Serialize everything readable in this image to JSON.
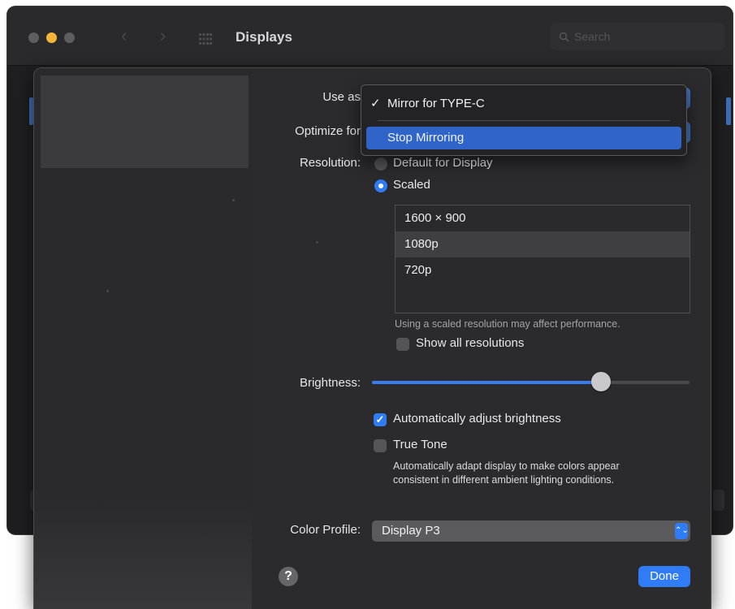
{
  "window": {
    "title": "Displays",
    "search_placeholder": "Search",
    "back_glyph": "‹",
    "forward_glyph": "›"
  },
  "sheet": {
    "use_as_label": "Use as",
    "optimize_for_label": "Optimize for",
    "resolution_label": "Resolution:",
    "resolution_options": {
      "default": "Default for Display",
      "scaled": "Scaled"
    },
    "resolution_selected": "scaled",
    "scaled_resolutions": [
      "1600 × 900",
      "1080p",
      "720p"
    ],
    "scaled_selected": "1080p",
    "scaled_note": "Using a scaled resolution may affect performance.",
    "show_all_resolutions_label": "Show all resolutions",
    "show_all_resolutions_checked": false,
    "brightness_label": "Brightness:",
    "brightness_level": 0.72,
    "auto_brightness_label": "Automatically adjust brightness",
    "auto_brightness_checked": true,
    "true_tone_label": "True Tone",
    "true_tone_checked": false,
    "true_tone_description_line1": "Automatically adapt display to make colors appear",
    "true_tone_description_line2": "consistent in different ambient lighting conditions.",
    "color_profile_label": "Color Profile:",
    "color_profile_value": "Display P3",
    "help_glyph": "?",
    "done_label": "Done"
  },
  "use_as_menu": {
    "items": [
      {
        "label": "Mirror for TYPE-C",
        "checked": true,
        "highlighted": false
      },
      {
        "label": "Stop Mirroring",
        "checked": false,
        "highlighted": true
      }
    ],
    "check_glyph": "✓"
  },
  "icons": {
    "checkmark": "✓",
    "stepper": "⌃⌄"
  },
  "colors": {
    "accent": "#2f7cf6",
    "menu_highlight": "#2f65c9",
    "window_bg": "#1f1f21",
    "sheet_bg": "#2b2b2d",
    "minimize_yellow": "#f5b536"
  }
}
